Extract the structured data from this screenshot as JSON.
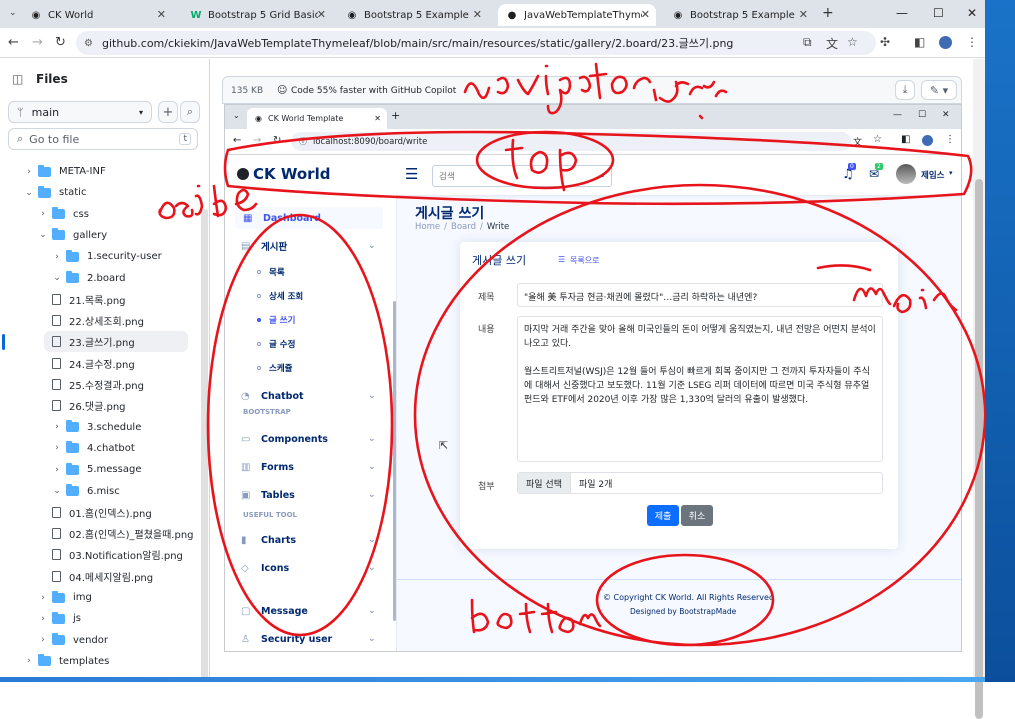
{
  "browser": {
    "tabs": [
      {
        "title": "CK World",
        "icon": "globe-icon"
      },
      {
        "title": "Bootstrap 5 Grid Basic",
        "icon": "w3schools-icon"
      },
      {
        "title": "Bootstrap 5 Example",
        "icon": "globe-icon"
      },
      {
        "title": "JavaWebTemplateThymeleaf/s",
        "icon": "github-icon",
        "active": true
      },
      {
        "title": "Bootstrap 5 Example",
        "icon": "globe-icon"
      }
    ],
    "new_tab": "+",
    "url": "github.com/ckiekim/JavaWebTemplateThymeleaf/blob/main/src/main/resources/static/gallery/2.board/23.글쓰기.png"
  },
  "github": {
    "files_label": "Files",
    "branch": "main",
    "goto_placeholder": "Go to file",
    "goto_shortcut": "t",
    "tree": [
      {
        "label": "META-INF",
        "type": "folder",
        "level": 1,
        "open": false
      },
      {
        "label": "static",
        "type": "folder",
        "level": 1,
        "open": true
      },
      {
        "label": "css",
        "type": "folder",
        "level": 2,
        "open": false
      },
      {
        "label": "gallery",
        "type": "folder",
        "level": 2,
        "open": true
      },
      {
        "label": "1.security-user",
        "type": "folder",
        "level": 3,
        "open": false
      },
      {
        "label": "2.board",
        "type": "folder",
        "level": 3,
        "open": true
      },
      {
        "label": "21.목록.png",
        "type": "file",
        "level": 4
      },
      {
        "label": "22.상세조회.png",
        "type": "file",
        "level": 4
      },
      {
        "label": "23.글쓰기.png",
        "type": "file",
        "level": 4,
        "selected": true
      },
      {
        "label": "24.글수정.png",
        "type": "file",
        "level": 4
      },
      {
        "label": "25.수정결과.png",
        "type": "file",
        "level": 4
      },
      {
        "label": "26.댓글.png",
        "type": "file",
        "level": 4
      },
      {
        "label": "3.schedule",
        "type": "folder",
        "level": 3,
        "open": false
      },
      {
        "label": "4.chatbot",
        "type": "folder",
        "level": 3,
        "open": false
      },
      {
        "label": "5.message",
        "type": "folder",
        "level": 3,
        "open": false
      },
      {
        "label": "6.misc",
        "type": "folder",
        "level": 3,
        "open": true
      },
      {
        "label": "01.홈(인덱스).png",
        "type": "file",
        "level": 4
      },
      {
        "label": "02.홈(인덱스)_펼쳤을때.png",
        "type": "file",
        "level": 4
      },
      {
        "label": "03.Notification알림.png",
        "type": "file",
        "level": 4
      },
      {
        "label": "04.메세지알림.png",
        "type": "file",
        "level": 4
      },
      {
        "label": "img",
        "type": "folder",
        "level": 2,
        "open": false
      },
      {
        "label": "js",
        "type": "folder",
        "level": 2,
        "open": false
      },
      {
        "label": "vendor",
        "type": "folder",
        "level": 2,
        "open": false
      },
      {
        "label": "templates",
        "type": "folder",
        "level": 1,
        "open": false
      }
    ],
    "file_size": "135 KB",
    "copilot": "Code 55% faster with GitHub Copilot"
  },
  "inner": {
    "tab_title": "CK World Template",
    "url": "localhost:8090/board/write",
    "brand": "CK World",
    "search_placeholder": "검색",
    "notif_count": "0",
    "msg_count": "2",
    "user_name": "제임스",
    "aside": {
      "dashboard": "Dashboard",
      "board": "게시판",
      "sub": [
        "목록",
        "상세 조회",
        "글 쓰기",
        "글 수정",
        "스케쥴"
      ],
      "chatbot": "Chatbot",
      "head_bootstrap": "BOOTSTRAP",
      "components": "Components",
      "forms": "Forms",
      "tables": "Tables",
      "head_useful": "USEFUL TOOL",
      "charts": "Charts",
      "icons": "Icons",
      "message": "Message",
      "security": "Security user"
    },
    "page_title": "게시글 쓰기",
    "crumb": [
      "Home",
      "Board",
      "Write"
    ],
    "card_title": "게시글 쓰기",
    "list_link": "목록으로",
    "label_title": "제목",
    "title_value": "\"올해 美 투자금 현금·채권에 몰렸다\"…금리 하락하는 내년엔?",
    "label_content": "내용",
    "content_p1": "마지막 거래 주간을 맞아 올해 미국인들의 돈이 어떻게 움직였는지, 내년 전망은 어떤지 분석이 나오고 있다.",
    "content_p2": "월스트리트저널(WSJ)은 12월 들어 투심이 빠르게 회복 중이지만 그 전까지 투자자들이 주식에 대해서 신중했다고 보도했다. 11월 기준 LSEG 리퍼 데이터에 따르면 미국 주식형 뮤추얼펀드와 ETF에서 2020년 이후 가장 많은 1,330억 달러의 유출이 발생했다.",
    "label_attach": "첨부",
    "file_btn": "파일 선택",
    "file_value": "파일 2개",
    "submit": "제출",
    "cancel": "취소",
    "footer_copy": "© Copyright CK World. All Rights Reserved",
    "footer_designed": "Designed by BootstrapMade"
  },
  "colors": {
    "accent": "#4154f1",
    "navy": "#012970",
    "ink": "#e8141c",
    "submit": "#0d6efd",
    "cancel": "#6c757d"
  }
}
